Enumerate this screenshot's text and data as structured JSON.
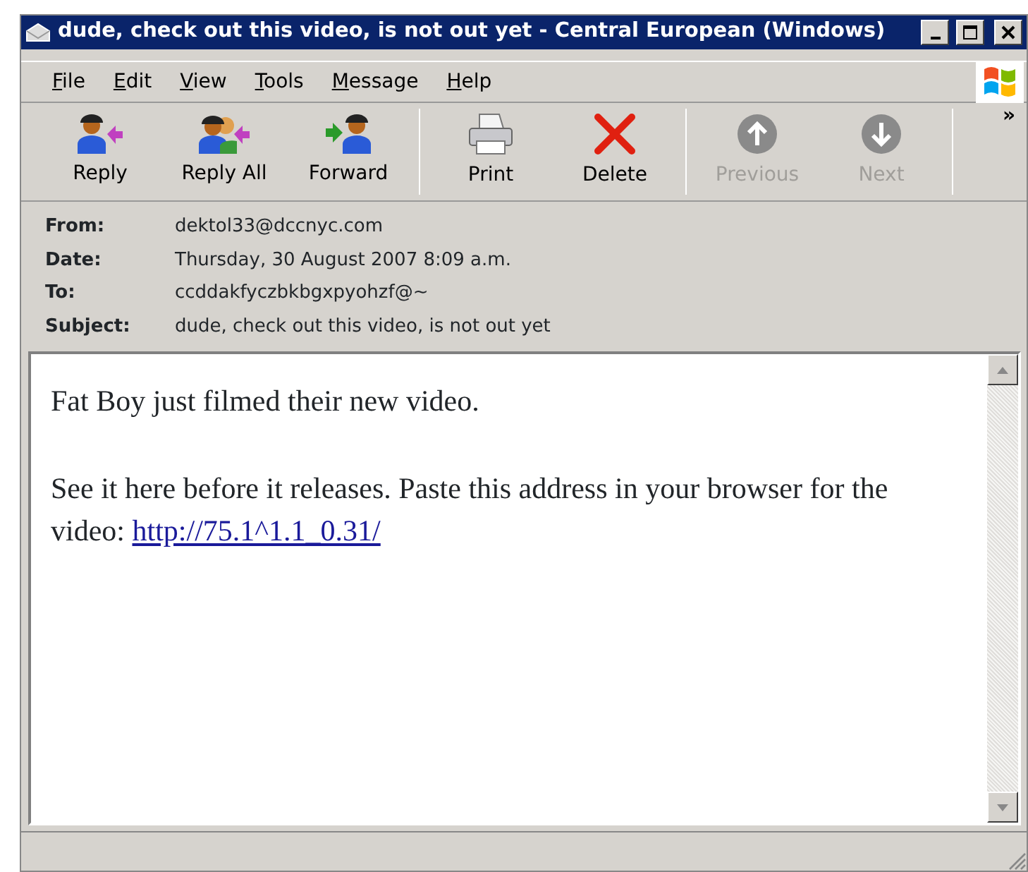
{
  "window": {
    "title": "dude, check out this video, is not out yet - Central European (Windows)"
  },
  "menu": [
    "File",
    "Edit",
    "View",
    "Tools",
    "Message",
    "Help"
  ],
  "toolbar": [
    {
      "kind": "reply",
      "label": "Reply",
      "disabled": false
    },
    {
      "kind": "reply_all",
      "label": "Reply All",
      "disabled": false
    },
    {
      "kind": "forward",
      "label": "Forward",
      "disabled": false
    },
    {
      "kind": "print",
      "label": "Print",
      "disabled": false
    },
    {
      "kind": "delete",
      "label": "Delete",
      "disabled": false
    },
    {
      "kind": "previous",
      "label": "Previous",
      "disabled": true
    },
    {
      "kind": "next",
      "label": "Next",
      "disabled": true
    }
  ],
  "toolbar_overflow": "»",
  "headers": [
    {
      "label": "From:",
      "value": "dektol33@dccnyc.com"
    },
    {
      "label": "Date:",
      "value": "Thursday, 30 August 2007 8:09 a.m."
    },
    {
      "label": "To:",
      "value": "ccddakfyczbkbgxpyohzf@~"
    },
    {
      "label": "Subject:",
      "value": "dude, check out this video, is not out yet"
    }
  ],
  "body": {
    "paragraphs": [
      "Fat Boy just filmed their new video."
    ],
    "text": "See it here before it releases. Paste this address in your browser for the video:",
    "link": "http://75.1^1.1_0.31/"
  }
}
